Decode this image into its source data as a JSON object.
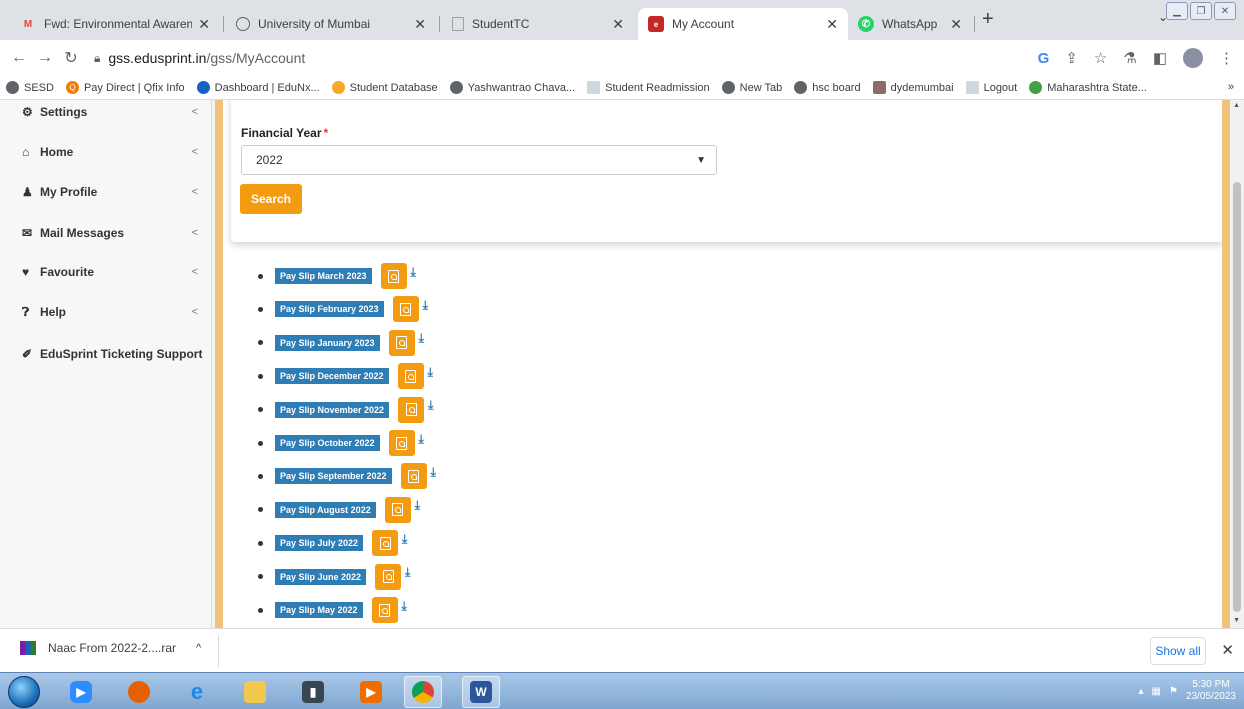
{
  "browser": {
    "tabs": [
      {
        "title": "Fwd: Environmental Awareness",
        "icon": "gmail-icon",
        "color": "#ea4335"
      },
      {
        "title": "University of Mumbai",
        "icon": "globe-icon",
        "color": "#5f6368"
      },
      {
        "title": "StudentTC",
        "icon": "page-icon",
        "color": "#9aa0a6"
      },
      {
        "title": "My Account",
        "icon": "edusprint-icon",
        "color": "#c62828",
        "active": true
      },
      {
        "title": "WhatsApp",
        "icon": "whatsapp-icon",
        "color": "#25d366"
      }
    ],
    "url_host": "gss.edusprint.in",
    "url_path": "/gss/MyAccount",
    "bookmarks": [
      {
        "label": "SESD",
        "icon": "globe-icon",
        "color": "#5f6368"
      },
      {
        "label": "Pay Direct | Qfix Info",
        "icon": "qfix-icon",
        "color": "#f57c00"
      },
      {
        "label": "Dashboard | EduNx...",
        "icon": "edunx-icon",
        "color": "#1565c0"
      },
      {
        "label": "Student Database",
        "icon": "db-icon",
        "color": "#f9a825"
      },
      {
        "label": "Yashwantrao Chava...",
        "icon": "globe-icon",
        "color": "#5f6368"
      },
      {
        "label": "Student Readmission",
        "icon": "page-icon",
        "color": "#9aa0a6"
      },
      {
        "label": "New Tab",
        "icon": "globe-icon",
        "color": "#5f6368"
      },
      {
        "label": "hsc board",
        "icon": "globe-icon",
        "color": "#5f6368"
      },
      {
        "label": "dydemumbai",
        "icon": "emblem-icon",
        "color": "#8d6e63"
      },
      {
        "label": "Logout",
        "icon": "page-icon",
        "color": "#9aa0a6"
      },
      {
        "label": "Maharashtra State...",
        "icon": "msbte-icon",
        "color": "#43a047"
      }
    ],
    "bookmarks_more": "»"
  },
  "sidebar": {
    "items": [
      {
        "label": "Settings",
        "icon": "gears-icon",
        "glyph": "⚙"
      },
      {
        "label": "Home",
        "icon": "home-icon",
        "glyph": "⌂"
      },
      {
        "label": "My Profile",
        "icon": "user-icon",
        "glyph": "♟"
      },
      {
        "label": "Mail Messages",
        "icon": "mail-icon",
        "glyph": "✉"
      },
      {
        "label": "Favourite",
        "icon": "heart-icon",
        "glyph": "♥"
      },
      {
        "label": "Help",
        "icon": "question-circle-icon",
        "glyph": "?"
      },
      {
        "label": "EduSprint Ticketing Support",
        "icon": "ticket-icon",
        "glyph": "✐"
      }
    ],
    "chevron": "<"
  },
  "form": {
    "financial_year_label": "Financial Year",
    "required_mark": "*",
    "financial_year_value": "2022",
    "search_label": "Search"
  },
  "payslips": [
    "Pay Slip March 2023",
    "Pay Slip February 2023",
    "Pay Slip January 2023",
    "Pay Slip December 2022",
    "Pay Slip November 2022",
    "Pay Slip October 2022",
    "Pay Slip September 2022",
    "Pay Slip August 2022",
    "Pay Slip July 2022",
    "Pay Slip June 2022",
    "Pay Slip May 2022"
  ],
  "downloads": {
    "file_name": "Naac From 2022-2....rar",
    "show_all": "Show all"
  },
  "taskbar": {
    "time": "5:30 PM",
    "date": "23/05/2023"
  },
  "colors": {
    "accent_orange": "#f39c12",
    "label_blue": "#2f7db5",
    "gold_border": "#f1c27a"
  }
}
